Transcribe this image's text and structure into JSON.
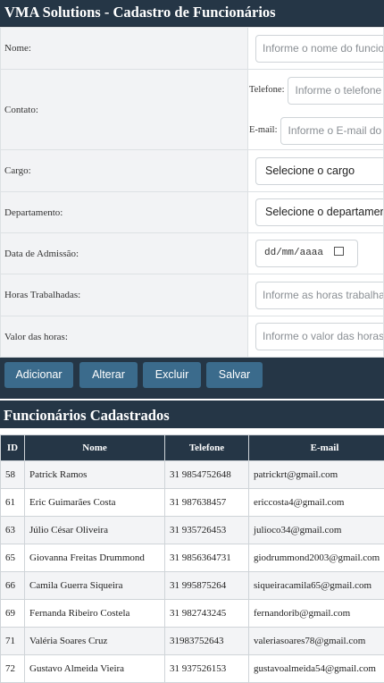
{
  "title": "VMA Solutions - Cadastro de Funcionários",
  "form": {
    "nome_label": "Nome:",
    "nome_placeholder": "Informe o nome do funcionário",
    "contato_label": "Contato:",
    "telefone_label": "Telefone:",
    "telefone_placeholder": "Informe o telefone",
    "email_label": "E-mail:",
    "email_placeholder": "Informe o E-mail do funcionário",
    "cargo_label": "Cargo:",
    "cargo_value": "Selecione o cargo",
    "departamento_label": "Departamento:",
    "departamento_value": "Selecione o departamento",
    "admissao_label": "Data de Admissão:",
    "admissao_value": "dd/mm/aaaa",
    "horas_label": "Horas Trabalhadas:",
    "horas_placeholder": "Informe as horas trabalhadas",
    "valor_label": "Valor das horas:",
    "valor_placeholder": "Informe o valor das horas trabalhadas"
  },
  "buttons": {
    "adicionar": "Adicionar",
    "alterar": "Alterar",
    "excluir": "Excluir",
    "salvar": "Salvar"
  },
  "list": {
    "title": "Funcionários Cadastrados",
    "headers": [
      "ID",
      "Nome",
      "Telefone",
      "E-mail"
    ],
    "rows": [
      {
        "id": "58",
        "nome": "Patrick Ramos",
        "telefone": "31 9854752648",
        "email": "patrickrt@gmail.com"
      },
      {
        "id": "61",
        "nome": "Eric Guimarães Costa",
        "telefone": "31 987638457",
        "email": "ericcosta4@gmail.com"
      },
      {
        "id": "63",
        "nome": "Júlio César Oliveira",
        "telefone": "31 935726453",
        "email": "julioco34@gmail.com"
      },
      {
        "id": "65",
        "nome": "Giovanna Freitas Drummond",
        "telefone": "31 9856364731",
        "email": "giodrummond2003@gmail.com"
      },
      {
        "id": "66",
        "nome": "Camila Guerra Siqueira",
        "telefone": "31 995875264",
        "email": "siqueiracamila65@gmail.com"
      },
      {
        "id": "69",
        "nome": "Fernanda Ribeiro Costela",
        "telefone": "31 982743245",
        "email": "fernandorib@gmail.com"
      },
      {
        "id": "71",
        "nome": "Valéria Soares Cruz",
        "telefone": "31983752643",
        "email": "valeriasoares78@gmail.com"
      },
      {
        "id": "72",
        "nome": "Gustavo Almeida Vieira",
        "telefone": "31 937526153",
        "email": "gustavoalmeida54@gmail.com"
      }
    ]
  }
}
